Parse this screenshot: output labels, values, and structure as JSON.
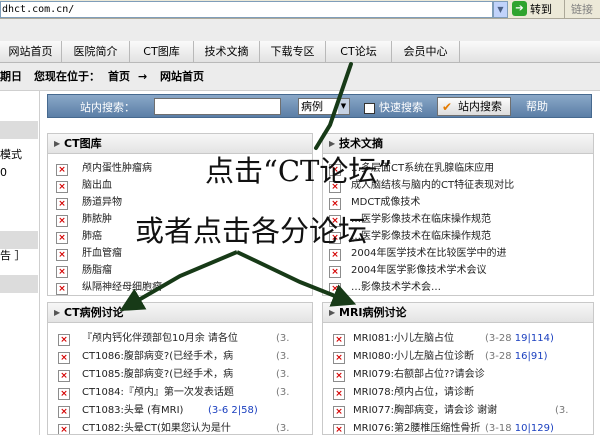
{
  "browser": {
    "address": "dhct.com.cn/",
    "go_label": "转到",
    "links_label": "链接"
  },
  "nav": {
    "items": [
      "网站首页",
      "医院简介",
      "CT图库",
      "技术文摘",
      "下载专区",
      "CT论坛",
      "会员中心"
    ]
  },
  "crumb": {
    "weekday_fragment": "期日",
    "location_label": "您现在位于：",
    "home": "首页",
    "arrow": "→",
    "current": "网站首页"
  },
  "sidebar": {
    "fragments": [
      "模式",
      "0",
      "告 ］"
    ]
  },
  "search": {
    "label": "站内搜索：",
    "input_value": "",
    "select_value": "病例",
    "quick_label": "快速搜索",
    "button_label": "站内搜索",
    "help_label": "帮助"
  },
  "panels": {
    "ct_gallery": {
      "title": "CT图库",
      "items": [
        "颅内蛋性肿瘤病",
        "脑出血",
        "肠道异物",
        "肺脓肿",
        "肺癌",
        "肝血管瘤",
        "肠脂瘤",
        "纵隔神经母细胞瘤"
      ]
    },
    "tech_digest": {
      "title": "技术文摘",
      "items": [
        "…多层面CT系统在乳腺临床应用",
        "成人脑结核与脑内的CT特征表现对比",
        "MDCT成像技术",
        "…医学影像技术在临床操作规范",
        "…医学影像技术在临床操作规范",
        "2004年医学技术在比较医学中的进",
        "2004年医学影像技术学术会议",
        "…影像技术学术会…"
      ]
    },
    "ct_cases": {
      "title": "CT病例讨论",
      "items": [
        {
          "text": "『颅内钙化伴颈部包10月余 请各位",
          "date": "(3."
        },
        {
          "text": "CT1086:腹部病变?(已经手术，病",
          "date": "(3."
        },
        {
          "text": "CT1085:腹部病变?(已经手术，病",
          "date": "(3."
        },
        {
          "text": "CT1084:『颅内』第一次发表话题",
          "date": "(3."
        },
        {
          "text": "CT1083:头晕 (有MRI)",
          "date": "(3-6 2|58)"
        },
        {
          "text": "CT1082:头晕CT(如果您认为是什",
          "date": "(3."
        }
      ]
    },
    "mri_cases": {
      "title": "MRI病例讨论",
      "items": [
        {
          "text": "MRI081:小儿左脑占位",
          "date": "(3-28 ",
          "num": "19|114)"
        },
        {
          "text": "MRI080:小儿左脑占位诊断",
          "date": "(3-28 ",
          "num": "16|91)"
        },
        {
          "text": "MRI079:右额部占位??请会诊",
          "date": "",
          "num": ""
        },
        {
          "text": "MRI078:颅内占位，请诊断",
          "date": "",
          "num": ""
        },
        {
          "text": "MRI077:胸部病变，请会诊 谢谢",
          "date": "(3.",
          "num": ""
        },
        {
          "text": "MRI076:第2腰椎压缩性骨折",
          "date": "(3-18 ",
          "num": "10|129)"
        }
      ]
    }
  },
  "annotations": {
    "click_forum": "点击“CT论坛”",
    "or_click_sections": "或者点击各分论坛"
  }
}
